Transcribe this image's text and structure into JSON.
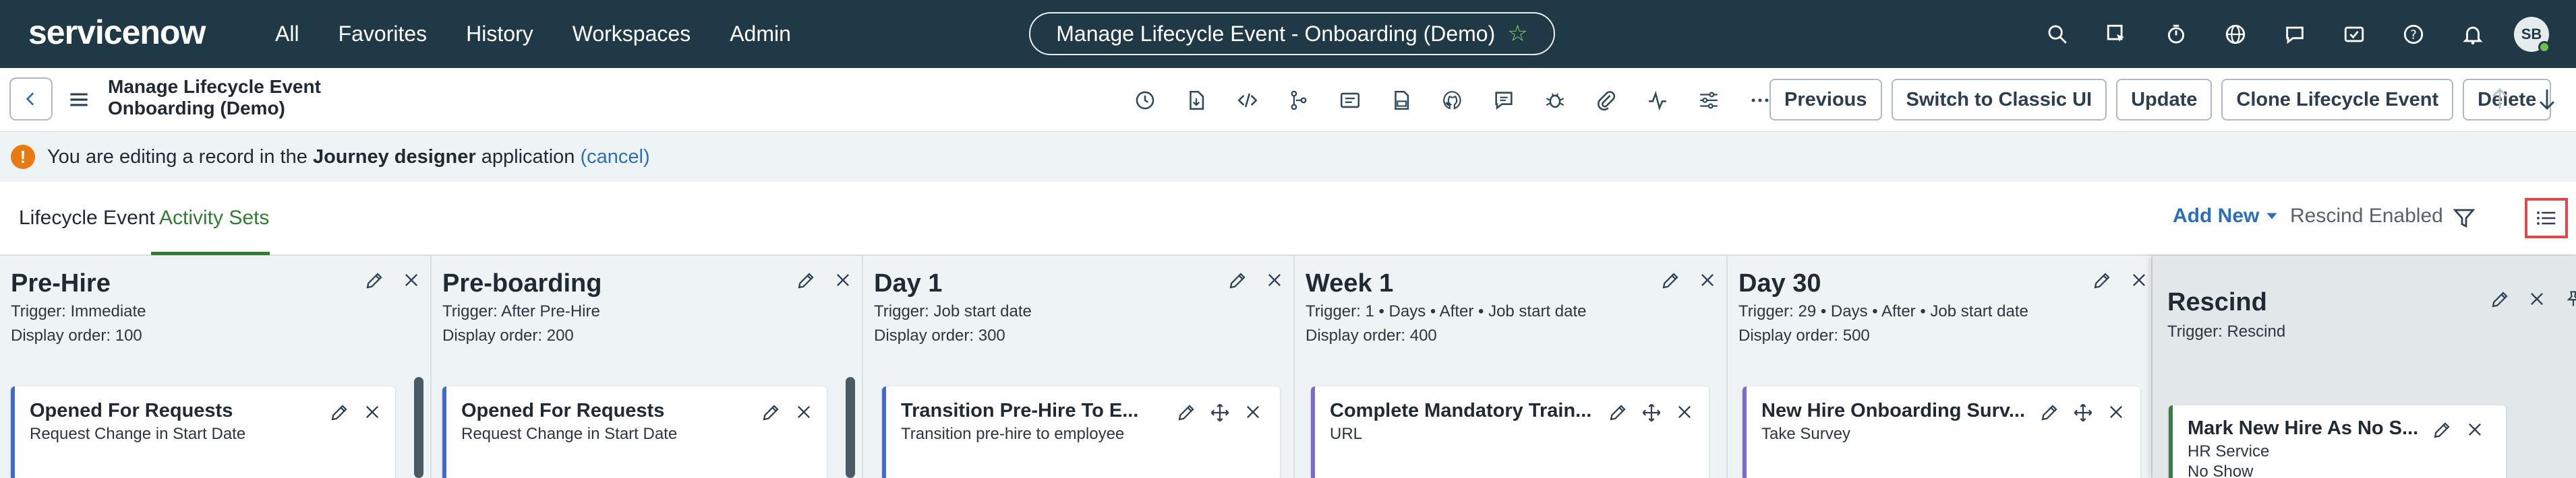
{
  "topnav": {
    "logo": "servicenow",
    "links": [
      "All",
      "Favorites",
      "History",
      "Workspaces",
      "Admin"
    ],
    "title": "Manage Lifecycle Event - Onboarding (Demo)",
    "avatar_initials": "SB"
  },
  "record": {
    "title_line1": "Manage Lifecycle Event",
    "title_line2": "Onboarding (Demo)",
    "buttons": {
      "previous": "Previous",
      "switch_classic": "Switch to Classic UI",
      "update": "Update",
      "clone": "Clone Lifecycle Event",
      "delete": "Delete"
    }
  },
  "banner": {
    "prefix": "You are editing a record in the ",
    "app": "Journey designer",
    "suffix": " application ",
    "cancel": "(cancel)"
  },
  "tabs": {
    "items": [
      "Lifecycle Event",
      "Activity Sets"
    ],
    "add_new": "Add New",
    "rescind_enabled": "Rescind Enabled"
  },
  "columns": [
    {
      "title": "Pre-Hire",
      "trigger": "Trigger: Immediate",
      "order": "Display order: 100",
      "card": {
        "title": "Opened For Requests",
        "sub": "Request Change in Start Date"
      }
    },
    {
      "title": "Pre-boarding",
      "trigger": "Trigger: After Pre-Hire",
      "order": "Display order: 200",
      "card": {
        "title": "Opened For Requests",
        "sub": "Request Change in Start Date"
      }
    },
    {
      "title": "Day 1",
      "trigger": "Trigger: Job start date",
      "order": "Display order: 300",
      "card": {
        "title": "Transition Pre-Hire To E...",
        "sub": "Transition pre-hire to employee"
      }
    },
    {
      "title": "Week 1",
      "trigger": "Trigger: 1 • Days • After • Job start date",
      "order": "Display order: 400",
      "card": {
        "title": "Complete Mandatory Train...",
        "sub": "URL"
      }
    },
    {
      "title": "Day 30",
      "trigger": "Trigger: 29 • Days • After • Job start date",
      "order": "Display order: 500",
      "card": {
        "title": "New Hire Onboarding Surv...",
        "sub": "Take Survey"
      }
    }
  ],
  "rescind": {
    "title": "Rescind",
    "trigger": "Trigger: Rescind",
    "card": {
      "title": "Mark New Hire As No S...",
      "sub": "HR Service",
      "sub2": "No Show"
    }
  },
  "colors": {
    "nav_bg": "#1f3a46",
    "accent_green": "#2e7d32",
    "link_blue": "#2a6fb8",
    "warning": "#e77b12",
    "card_border_blue": "#4468c9",
    "card_border_purple": "#7b6cc4",
    "highlight_red": "#e24848"
  }
}
